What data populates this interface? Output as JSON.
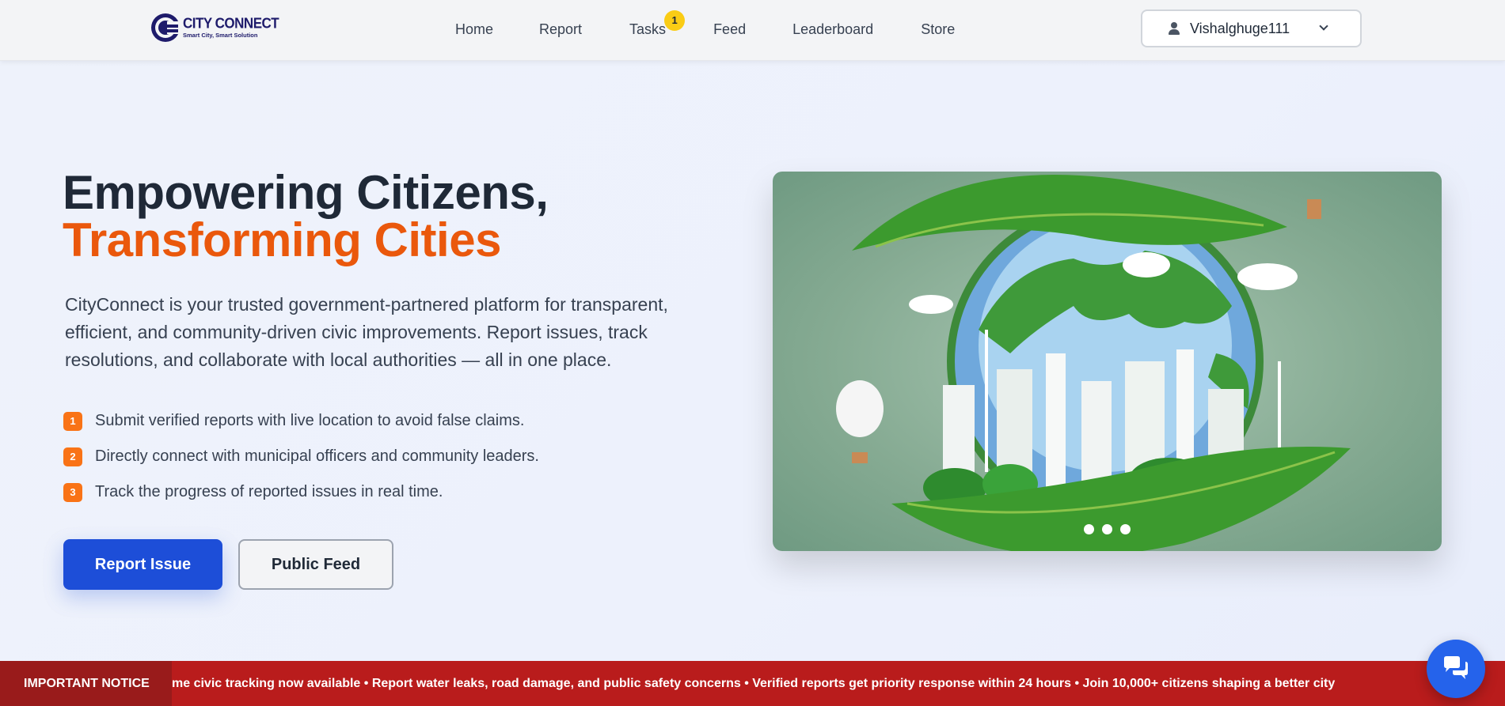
{
  "header": {
    "logo": {
      "title": "CITY CONNECT",
      "subtitle": "Smart City, Smart Solution",
      "icon": "city-connect-logo"
    },
    "nav": [
      {
        "label": "Home"
      },
      {
        "label": "Report"
      },
      {
        "label": "Tasks",
        "badge": "1"
      },
      {
        "label": "Feed"
      },
      {
        "label": "Leaderboard"
      },
      {
        "label": "Store"
      }
    ],
    "user": {
      "name": "Vishalghuge111",
      "icon": "user-icon",
      "dropdown_icon": "chevron-down-icon"
    }
  },
  "hero": {
    "title_line1": "Empowering Citizens,",
    "title_line2": "Transforming Cities",
    "description": "CityConnect is your trusted government-partnered platform for transparent, efficient, and community-driven civic improvements. Report issues, track resolutions, and collaborate with local authorities — all in one place.",
    "features": [
      {
        "num": "1",
        "text": "Submit verified reports with live location to avoid false claims."
      },
      {
        "num": "2",
        "text": "Directly connect with municipal officers and community leaders."
      },
      {
        "num": "3",
        "text": "Track the progress of reported issues in real time."
      }
    ],
    "primary_button": "Report Issue",
    "secondary_button": "Public Feed",
    "carousel": {
      "slides": 3,
      "image": "green eco city on globe illustration"
    }
  },
  "notice": {
    "label": "IMPORTANT NOTICE",
    "text": "me civic tracking now available • Report water leaks, road damage, and public safety concerns • Verified reports get priority response within 24 hours • Join 10,000+ citizens shaping a better city"
  },
  "chat": {
    "icon": "chat-icon"
  },
  "colors": {
    "primary": "#1d4ed8",
    "accent": "#ea580c",
    "notice": "#b91c1c",
    "badge": "#facc15"
  }
}
